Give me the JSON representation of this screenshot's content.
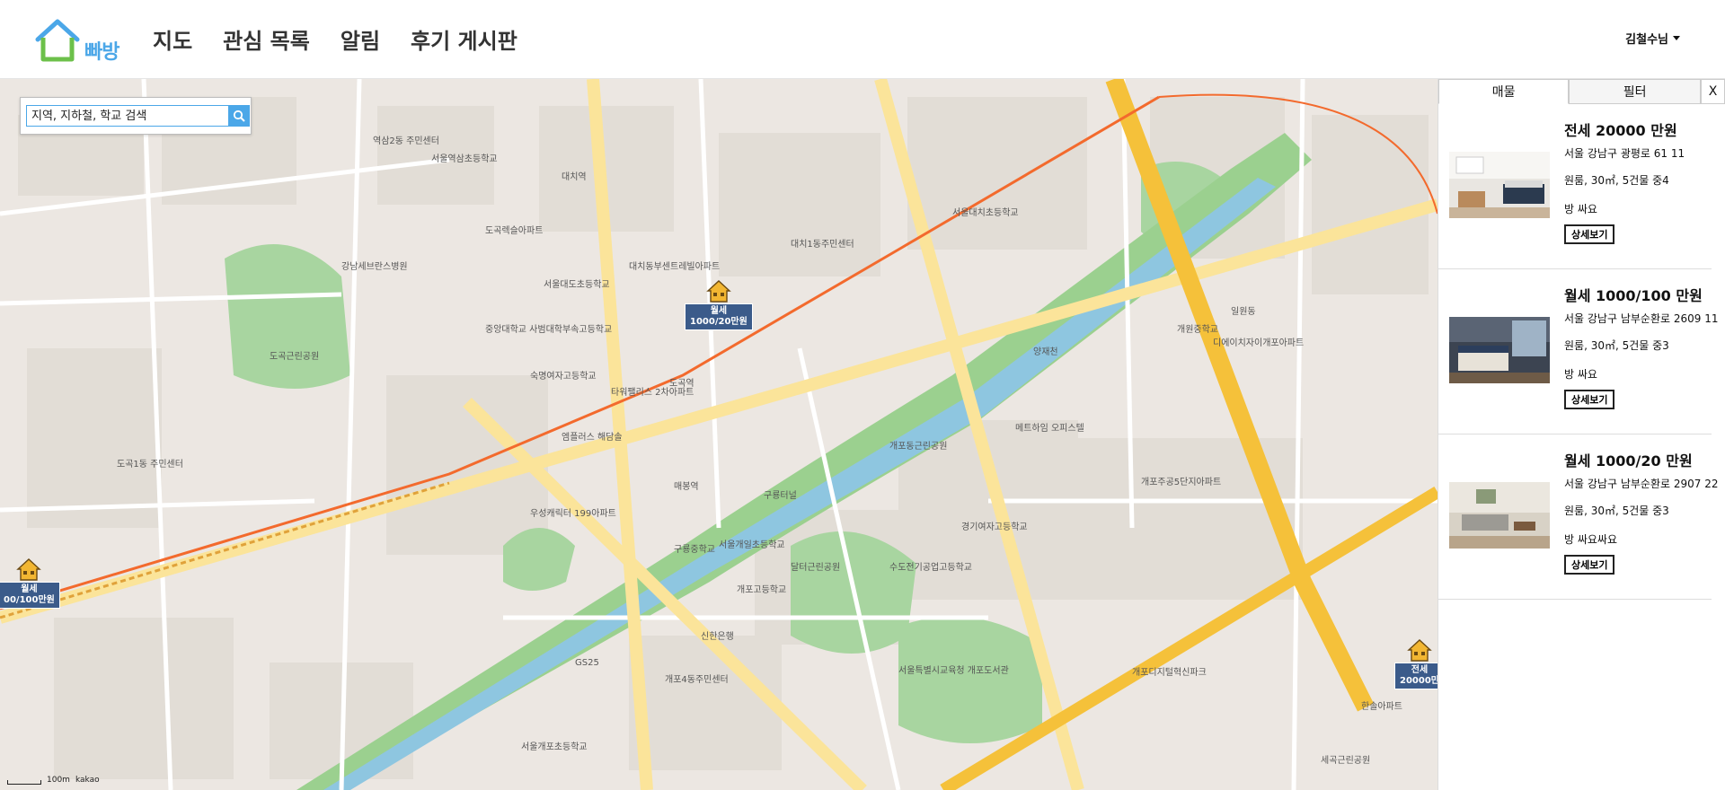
{
  "header": {
    "logo_text": "빠방",
    "nav": [
      "지도",
      "관심 목록",
      "알림",
      "후기 게시판"
    ],
    "user_label": "김철수님"
  },
  "search": {
    "placeholder": "지역, 지하철, 학교 검색"
  },
  "map": {
    "markers": [
      {
        "type": "월세",
        "price": "1000/20만원"
      },
      {
        "type": "월세",
        "price": "00/100만원"
      },
      {
        "type": "전세",
        "price": "20000만"
      }
    ],
    "labels": [
      "역삼2동 주민센터",
      "서울역삼초등학교",
      "강남세브란스병원",
      "도곡근린공원",
      "대치동부센트레빌아파트",
      "대치역",
      "서울대도초등학교",
      "중앙대학교 사범대학부속고등학교",
      "숙명여자고등학교",
      "도곡역",
      "타워팰리스 2차아파트",
      "엠플러스 해담솔",
      "도곡렉슬아파트",
      "매봉역",
      "개포동근린공원",
      "양재천",
      "서울개일초등학교",
      "개포고등학교",
      "달터근린공원",
      "구룡중학교",
      "수도전기공업고등학교",
      "경기여자고등학교",
      "서울대치초등학교",
      "대치1동주민센터",
      "개원중학교",
      "개포주공5단지아파트",
      "메트하임 오피스텔",
      "일원동",
      "세곡근린공원",
      "개포디지털혁신파크",
      "도곡1동 주민센터",
      "우성캐릭터 199아파트",
      "서울개포초등학교",
      "디에이치자이개포아파트",
      "구룡터널",
      "개포4동주민센터",
      "서울특별시교육청 개포도서관",
      "한솔아파트",
      "신한은행",
      "GS25"
    ],
    "scale_label": "100m",
    "provider": "kakao"
  },
  "panel": {
    "tabs": [
      "매물",
      "필터"
    ],
    "close_label": "X",
    "listings": [
      {
        "title": "전세 20000 만원",
        "address": "서울 강남구 광평로 61 11",
        "info": "원룸, 30㎡, 5건물 중4",
        "options": "방 싸요",
        "button": "상세보기"
      },
      {
        "title": "월세 1000/100 만원",
        "address": "서울 강남구 남부순환로 2609 11",
        "info": "원룸, 30㎡, 5건물 중3",
        "options": "방 싸요",
        "button": "상세보기"
      },
      {
        "title": "월세 1000/20 만원",
        "address": "서울 강남구 남부순환로 2907 22",
        "info": "원룸, 30㎡, 5건물 중3",
        "options": "방 싸요싸요",
        "button": "상세보기"
      }
    ]
  },
  "colors": {
    "brand": "#4ba7e8",
    "marker": "#3b5b8a",
    "highway": "#f5c13a",
    "park": "#a8d5a0",
    "river": "#8ec6e0"
  },
  "icons": [
    "house-logo-icon",
    "search-icon",
    "chevron-down-icon",
    "house-marker-icon",
    "close-icon"
  ]
}
